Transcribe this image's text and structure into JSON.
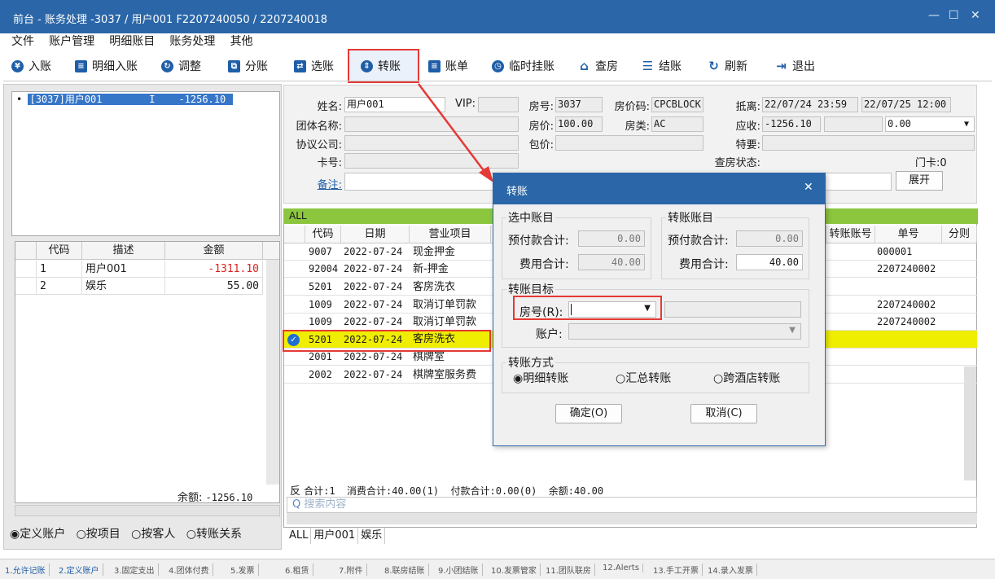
{
  "window": {
    "title": "前台 - 账务处理 -3037 / 用户001  F2207240050 / 2207240018",
    "minimize": "—",
    "maximize": "☐",
    "close": "✕"
  },
  "menu": [
    "文件",
    "账户管理",
    "明细账目",
    "账务处理",
    "其他"
  ],
  "toolbar": {
    "post": "入账",
    "detail_post": "明细入账",
    "adjust": "调整",
    "split": "分账",
    "select": "选账",
    "transfer": "转账",
    "bill": "账单",
    "temp_hold": "临时挂账",
    "check_room": "查房",
    "checkout": "结账",
    "refresh": "刷新",
    "exit": "退出"
  },
  "left": {
    "tree_item_id": "[3037]用户001",
    "tree_item_flag": "I",
    "tree_item_amount": "-1256.10",
    "grid_headers": [
      "代码",
      "描述",
      "金额"
    ],
    "rows": [
      {
        "code": "1",
        "desc": "用户001",
        "amount": "-1311.10"
      },
      {
        "code": "2",
        "desc": "娱乐",
        "amount": "55.00"
      }
    ],
    "balance_label": "余额:",
    "balance_value": "-1256.10",
    "radio_options": [
      "定义账户",
      "按项目",
      "按客人",
      "转账关系"
    ]
  },
  "guest": {
    "name_label": "姓名:",
    "name_value": "用户001",
    "vip_label": "VIP:",
    "room_label": "房号:",
    "room_value": "3037",
    "rate_code_label": "房价码:",
    "rate_code_value": "CPCBLOCK",
    "arrival_label": "抵离:",
    "arrival_value": "22/07/24 23:59",
    "departure_value": "22/07/25 12:00",
    "group_label": "团体名称:",
    "rate_label": "房价:",
    "rate_value": "100.00",
    "room_type_label": "房类:",
    "room_type_value": "AC",
    "receivable_label": "应收:",
    "receivable_value": "-1256.10",
    "dropdown_value": "0.00",
    "company_label": "协议公司:",
    "package_label": "包价:",
    "special_label": "特要:",
    "card_label": "卡号:",
    "check_status_label": "查房状态:",
    "door_card_label": "门卡:",
    "door_card_value": "0",
    "remark_label": "备注:",
    "expand_button": "展开"
  },
  "grid": {
    "filter_label": "ALL",
    "headers": [
      "代码",
      "日期",
      "营业项目",
      "转账账号",
      "单号",
      "分则"
    ],
    "rows": [
      {
        "code": "9007",
        "date": "2022-07-24",
        "item": "现金押金",
        "doc": "000001"
      },
      {
        "code": "92004",
        "date": "2022-07-24",
        "item": "新-押金",
        "doc": "2207240002"
      },
      {
        "code": "5201",
        "date": "2022-07-24",
        "item": "客房洗衣",
        "doc": ""
      },
      {
        "code": "1009",
        "date": "2022-07-24",
        "item": "取消订单罚款",
        "doc": "2207240002"
      },
      {
        "code": "1009",
        "date": "2022-07-24",
        "item": "取消订单罚款",
        "doc": "2207240002"
      },
      {
        "code": "5201",
        "date": "2022-07-24",
        "item": "客房洗衣",
        "doc": ""
      },
      {
        "code": "2001",
        "date": "2022-07-24",
        "item": "棋牌室",
        "doc": ""
      },
      {
        "code": "2002",
        "date": "2022-07-24",
        "item": "棋牌室服务费",
        "doc": ""
      }
    ],
    "summary_prefix": "反",
    "summary": "合计:1  消费合计:40.00(1)  付款合计:0.00(0)  余额:40.00",
    "search_placeholder": "搜索内容",
    "tabs": [
      "ALL",
      "用户001",
      "娱乐"
    ]
  },
  "dialog": {
    "title": "转账",
    "close": "✕",
    "selected_group": "选中账目",
    "transfer_group": "转账账目",
    "prepay_label": "预付款合计:",
    "fee_label": "费用合计:",
    "sel_prepay": "0.00",
    "sel_fee": "40.00",
    "tr_prepay": "0.00",
    "tr_fee": "40.00",
    "target_group": "转账目标",
    "room_label": "房号(R):",
    "account_label": "账户:",
    "method_group": "转账方式",
    "methods": [
      "明细转账",
      "汇总转账",
      "跨酒店转账"
    ],
    "ok": "确定(O)",
    "cancel": "取消(C)"
  },
  "status_tabs": [
    "1.允许记账",
    "2.定义账户",
    "3.固定支出",
    "4.团体付费",
    "5.发票",
    "6.租赁",
    "7.附件",
    "8.联房结账",
    "9.小团结账",
    "10.发票管家",
    "11.团队联房",
    "12.Alerts",
    "13.手工开票",
    "14.录入发票"
  ],
  "colors": {
    "title_bar": "#2b67a8",
    "highlight_red": "#e53935",
    "filter_green": "#8cc63f",
    "selected_row_yellow": "#f0ee00",
    "negative_amount": "#e02020"
  }
}
